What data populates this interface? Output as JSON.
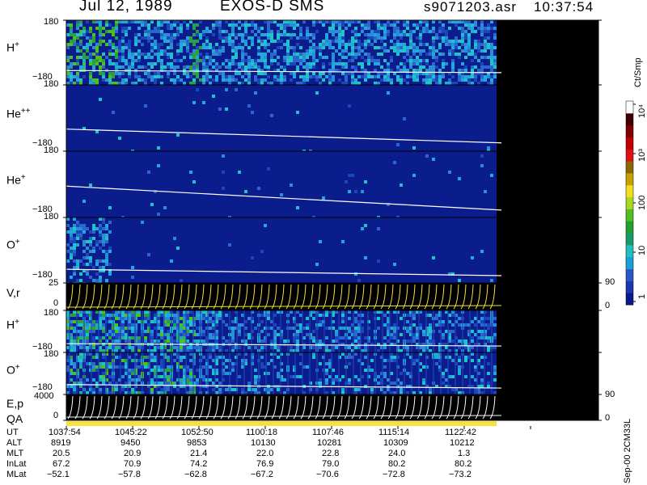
{
  "header": {
    "date": "Jul 12, 1989",
    "instrument": "EXOS-D SMS",
    "file": "s9071203.asr",
    "time": "10:37:54"
  },
  "colors": {
    "background": "#ffffff",
    "plot_bg": "#0b1c8c",
    "no_data": "#000000",
    "trace": "#ffffff",
    "yellow_trace": "#f5e23a"
  },
  "chart_data": [
    {
      "type": "heatmap",
      "label": "H",
      "label_sup": "+",
      "ylim": [
        -180,
        180
      ],
      "ytick_top": "180",
      "ytick_bottom": "−180",
      "trace": [
        -100,
        -112
      ]
    },
    {
      "type": "heatmap",
      "label": "He",
      "label_sup": "++",
      "ylim": [
        -180,
        180
      ],
      "ytick_top": "180",
      "ytick_bottom": "−180",
      "trace": [
        -60,
        -135
      ]
    },
    {
      "type": "heatmap",
      "label": "He",
      "label_sup": "+",
      "ylim": [
        -180,
        180
      ],
      "ytick_top": "180",
      "ytick_bottom": "−180",
      "trace": [
        -10,
        -140
      ]
    },
    {
      "type": "heatmap",
      "label": "O",
      "label_sup": "+",
      "ylim": [
        -180,
        180
      ],
      "ytick_top": "180",
      "ytick_bottom": "−180",
      "trace": [
        -105,
        -140
      ]
    },
    {
      "type": "line",
      "label": "V,r",
      "ylim": [
        0,
        25
      ],
      "ytick_top": "25",
      "ytick_bottom": "0",
      "right_ytick_top": "90",
      "right_ytick_bottom": "0"
    },
    {
      "type": "heatmap",
      "label": "H",
      "label_sup": "+",
      "ylim": [
        -180,
        180
      ],
      "ytick_top": "180",
      "ytick_bottom": "−180",
      "trace": [
        -105,
        -125
      ]
    },
    {
      "type": "heatmap",
      "label": "O",
      "label_sup": "+",
      "ylim": [
        -180,
        180
      ],
      "ytick_top": "180",
      "ytick_bottom": "−180",
      "trace": [
        -95,
        -125
      ]
    },
    {
      "type": "line",
      "label": "E,p",
      "ylim": [
        0,
        4000
      ],
      "ytick_top": "4000",
      "ytick_bottom": "0",
      "right_ytick_top": "90",
      "right_ytick_bottom": "0"
    },
    {
      "type": "bar",
      "label": "QA"
    }
  ],
  "colorbar": {
    "unit": "Ct/Smp",
    "ticks": [
      "1",
      "10",
      "100",
      "10³",
      "10⁴"
    ],
    "ticks_log": [
      0,
      1,
      2,
      3,
      4
    ],
    "colors": [
      "#0a1a8a",
      "#1a36b0",
      "#2a58c8",
      "#18a0d8",
      "#20c0c0",
      "#1a9a6a",
      "#20a030",
      "#50c020",
      "#a8d820",
      "#f0e020",
      "#c8a000",
      "#8a6a00",
      "#e01010",
      "#c00000",
      "#800000",
      "#400000",
      "#ffffff"
    ]
  },
  "table": {
    "rows": [
      {
        "label": "UT",
        "values": [
          "1037:54",
          "1045:22",
          "1052:50",
          "1100:18",
          "1107:46",
          "1115:14",
          "1122:42"
        ]
      },
      {
        "label": "ALT",
        "values": [
          "8919",
          "9450",
          "9853",
          "10130",
          "10281",
          "10309",
          "10212"
        ]
      },
      {
        "label": "MLT",
        "values": [
          "20.5",
          "20.9",
          "21.4",
          "22.0",
          "22.8",
          "24.0",
          "1.3"
        ]
      },
      {
        "label": "InLat",
        "values": [
          "67.2",
          "70.9",
          "74.2",
          "76.9",
          "79.0",
          "80.2",
          "80.2"
        ]
      },
      {
        "label": "MLat",
        "values": [
          "−52.1",
          "−57.8",
          "−62.8",
          "−67.2",
          "−70.6",
          "−72.8",
          "−73.2"
        ]
      }
    ]
  },
  "footer": {
    "version": "Sep-00 2CM33L"
  }
}
